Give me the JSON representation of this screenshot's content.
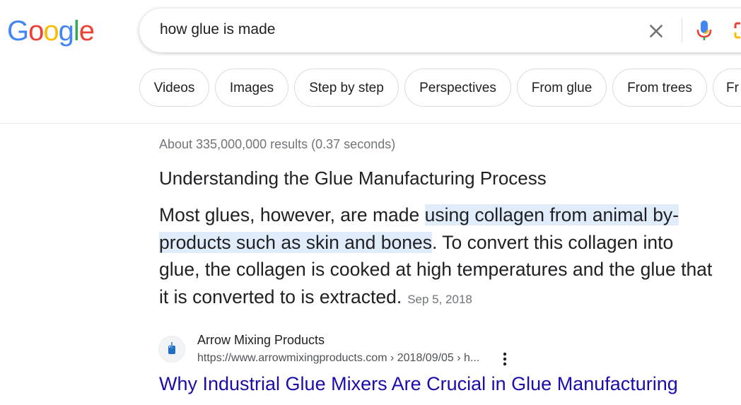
{
  "logo": {
    "letters": [
      "G",
      "o",
      "o",
      "g",
      "l",
      "e"
    ],
    "colors": [
      "#4285F4",
      "#EA4335",
      "#FBBC05",
      "#4285F4",
      "#34A853",
      "#EA4335"
    ]
  },
  "search": {
    "query": "how glue is made"
  },
  "icons": {
    "clear": "close-icon",
    "mic": "mic-icon",
    "lens": "lens-icon",
    "more": "more-vert-icon",
    "favicon": "mixer-favicon-icon"
  },
  "chips": [
    "Videos",
    "Images",
    "Step by step",
    "Perspectives",
    "From glue",
    "From trees",
    "Fr"
  ],
  "results_stats": "About 335,000,000 results (0.37 seconds)",
  "featured_snippet": {
    "title": "Understanding the Glue Manufacturing Process",
    "text_before": "Most glues, however, are made ",
    "text_highlight": "using collagen from animal by-products such as skin and bones",
    "text_after": ". To convert this collagen into glue, the collagen is cooked at high temperatures and the glue that it is converted to is extracted.",
    "date": "Sep 5, 2018",
    "highlight_color": "#e1ecfb"
  },
  "result": {
    "site_name": "Arrow Mixing Products",
    "url": "https://www.arrowmixingproducts.com › 2018/09/05 › h...",
    "title": "Why Industrial Glue Mixers Are Crucial in Glue Manufacturing",
    "title_color": "#1a0dab"
  }
}
